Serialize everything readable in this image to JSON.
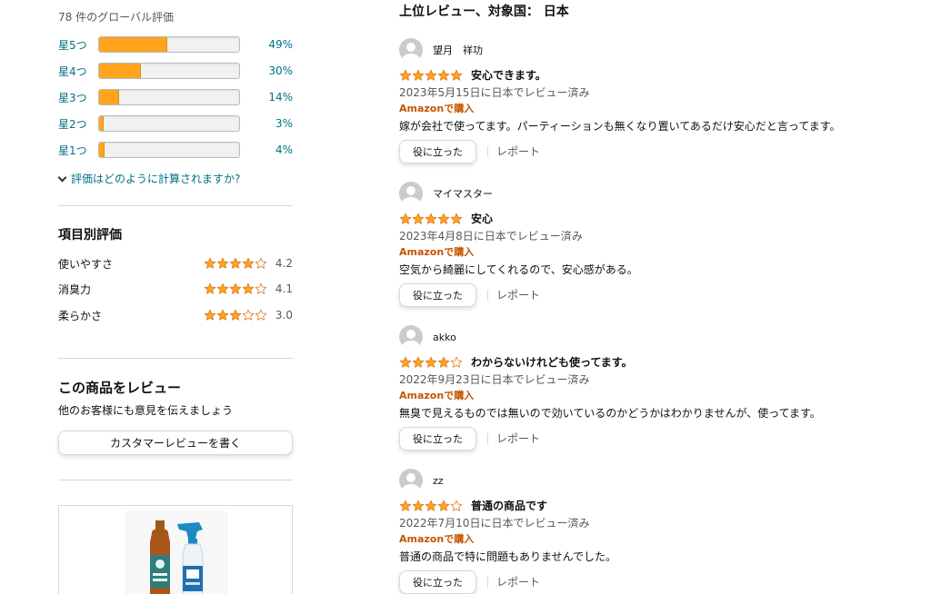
{
  "summary": {
    "global_count_text": "78 件のグローバル評価",
    "histogram": [
      {
        "label": "星5つ",
        "percent_text": "49%",
        "fill": 0.49
      },
      {
        "label": "星4つ",
        "percent_text": "30%",
        "fill": 0.3
      },
      {
        "label": "星3つ",
        "percent_text": "14%",
        "fill": 0.14
      },
      {
        "label": "星2つ",
        "percent_text": "3%",
        "fill": 0.03
      },
      {
        "label": "星1つ",
        "percent_text": "4%",
        "fill": 0.04
      }
    ],
    "how_calculated_link": "評価はどのように計算されますか?"
  },
  "feature_ratings": {
    "title": "項目別評価",
    "items": [
      {
        "name": "使いやすさ",
        "rating": 4.2,
        "value_text": "4.2"
      },
      {
        "name": "消臭力",
        "rating": 4.1,
        "value_text": "4.1"
      },
      {
        "name": "柔らかさ",
        "rating": 3.0,
        "value_text": "3.0"
      }
    ]
  },
  "write_review": {
    "title": "この商品をレビュー",
    "subtitle": "他のお客様にも意見を伝えましょう",
    "button_label": "カスタマーレビューを書く"
  },
  "reviews_heading": "上位レビュー、対象国： 日本",
  "reviews": [
    {
      "author": "望月　祥功",
      "stars": 5,
      "title": "安心できます。",
      "date": "2023年5月15日に日本でレビュー済み",
      "verified": "Amazonで購入",
      "body": "嫁が会社で使ってます。パーティーションも無くなり置いてあるだけ安心だと言ってます。",
      "helpful_label": "役に立った",
      "report_label": "レポート"
    },
    {
      "author": "マイマスター",
      "stars": 5,
      "title": "安心",
      "date": "2023年4月8日に日本でレビュー済み",
      "verified": "Amazonで購入",
      "body": "空気から綺麗にしてくれるので、安心感がある。",
      "helpful_label": "役に立った",
      "report_label": "レポート"
    },
    {
      "author": "akko",
      "stars": 4,
      "title": "わからないけれども使ってます。",
      "date": "2022年9月23日に日本でレビュー済み",
      "verified": "Amazonで購入",
      "body": "無臭で見えるものでは無いので効いているのかどうかはわかりませんが、使ってます。",
      "helpful_label": "役に立った",
      "report_label": "レポート"
    },
    {
      "author": "zz",
      "stars": 4,
      "title": "普通の商品です",
      "date": "2022年7月10日に日本でレビュー済み",
      "verified": "Amazonで購入",
      "body": "普通の商品で特に問題もありませんでした。",
      "helpful_label": "役に立った",
      "report_label": "レポート"
    }
  ],
  "colors": {
    "star": "#ffa41c",
    "link": "#007185",
    "verified": "#c45500"
  }
}
